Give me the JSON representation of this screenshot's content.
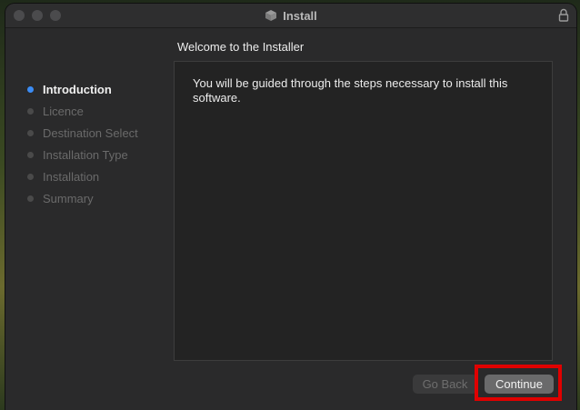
{
  "window": {
    "title": "Install",
    "title_icon": "installer-package-icon",
    "lock_icon": "lock-icon"
  },
  "header": {
    "heading": "Welcome to the  Installer"
  },
  "sidebar": {
    "steps": [
      {
        "label": "Introduction",
        "active": true
      },
      {
        "label": "Licence",
        "active": false
      },
      {
        "label": "Destination Select",
        "active": false
      },
      {
        "label": "Installation Type",
        "active": false
      },
      {
        "label": "Installation",
        "active": false
      },
      {
        "label": "Summary",
        "active": false
      }
    ]
  },
  "main": {
    "body_text": "You will be guided through the steps necessary to install this software."
  },
  "buttons": {
    "back_label": "Go Back",
    "continue_label": "Continue"
  },
  "colors": {
    "accent": "#3b8cf5",
    "highlight": "#e00000"
  }
}
